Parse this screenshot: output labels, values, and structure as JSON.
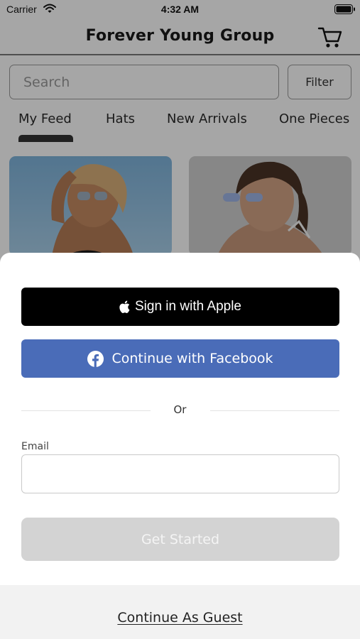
{
  "status_bar": {
    "carrier": "Carrier",
    "time": "4:32 AM",
    "wifi_icon": "wifi-icon",
    "battery_icon": "battery-icon"
  },
  "header": {
    "title": "Forever Young Group",
    "cart_icon": "cart-icon"
  },
  "search": {
    "placeholder": "Search",
    "value": ""
  },
  "filter": {
    "label": "Filter"
  },
  "tabs": [
    {
      "label": "My Feed",
      "selected": true
    },
    {
      "label": "Hats",
      "selected": false
    },
    {
      "label": "New Arrivals",
      "selected": false
    },
    {
      "label": "One Pieces",
      "selected": false
    }
  ],
  "sign_in_sheet": {
    "apple_label": "Sign in with Apple",
    "apple_icon": "apple-icon",
    "facebook_label": "Continue with Facebook",
    "facebook_icon": "facebook-icon",
    "or_label": "Or",
    "email_label": "Email",
    "email_value": "",
    "get_started_label": "Get Started",
    "guest_label": "Continue As Guest"
  },
  "colors": {
    "facebook_blue": "#4a6cb8",
    "apple_black": "#000000",
    "disabled_button": "#d3d3d3",
    "guest_area_bg": "#f2f2f2"
  }
}
